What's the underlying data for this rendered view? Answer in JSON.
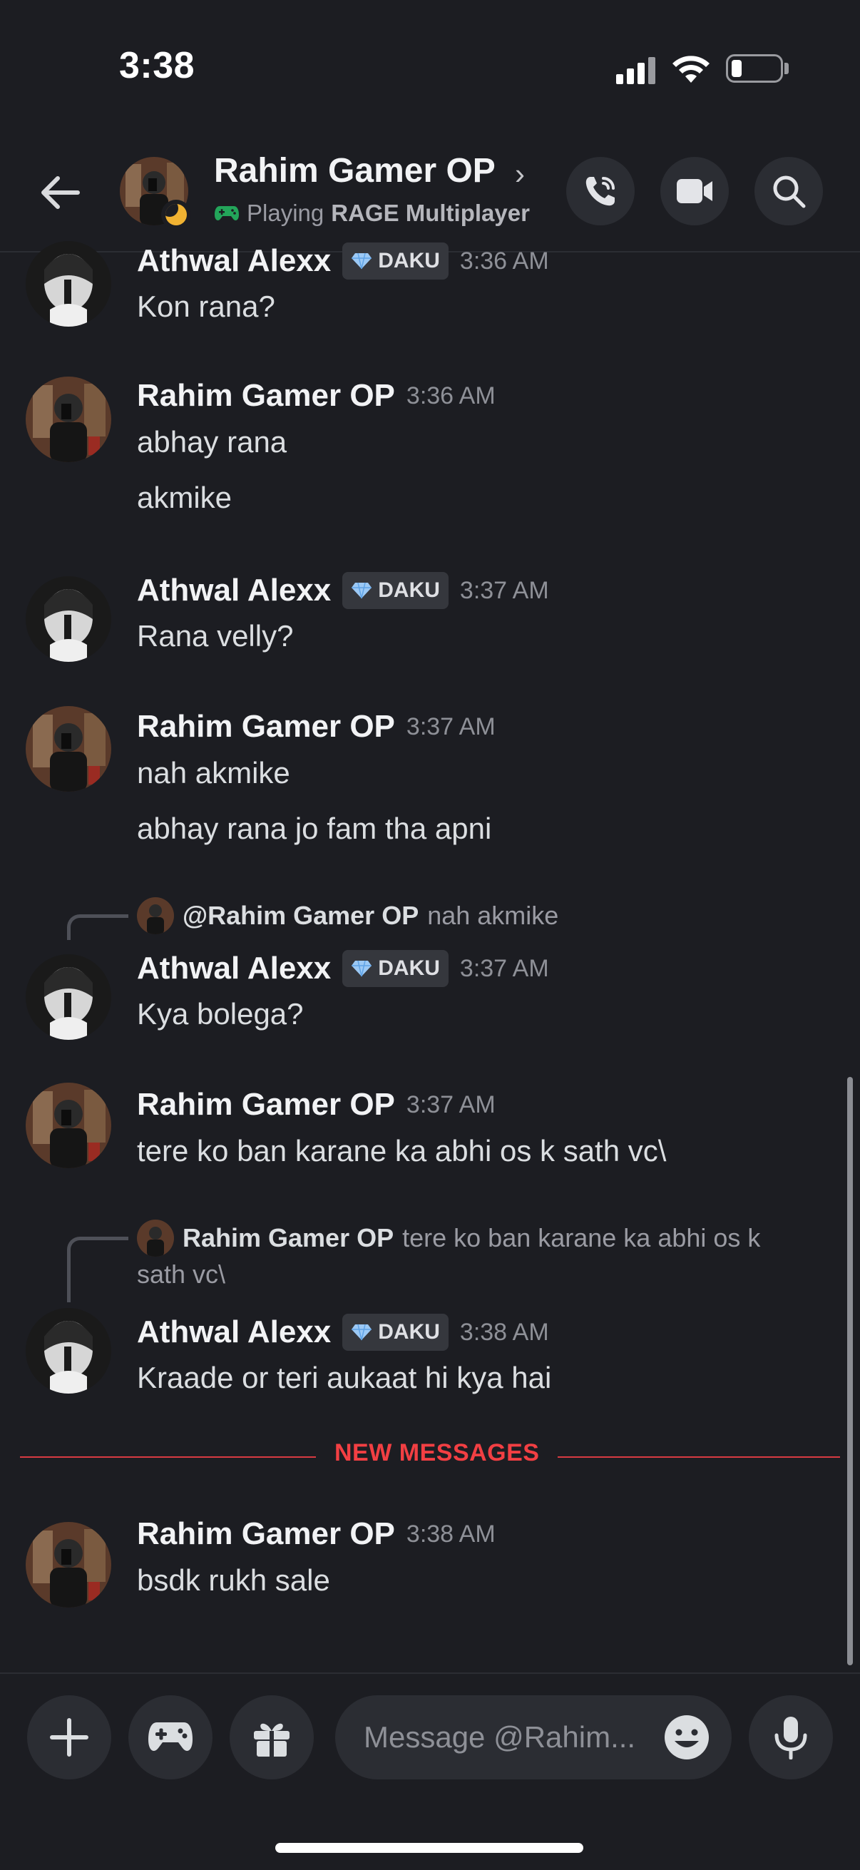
{
  "status_bar": {
    "time": "3:38"
  },
  "header": {
    "name": "Rahim Gamer OP",
    "activity_prefix": "Playing",
    "activity_game": "RAGE Multiplayer",
    "buttons": [
      "call-icon",
      "video-icon",
      "search-icon"
    ]
  },
  "messages": [
    {
      "author": "Athwal Alexx",
      "tag": "DAKU",
      "time": "3:36 AM",
      "lines": [
        "Kon rana?"
      ]
    },
    {
      "author": "Rahim Gamer OP",
      "time": "3:36 AM",
      "lines": [
        "abhay rana",
        "akmike"
      ]
    },
    {
      "author": "Athwal Alexx",
      "tag": "DAKU",
      "time": "3:37 AM",
      "lines": [
        "Rana velly?"
      ]
    },
    {
      "author": "Rahim Gamer OP",
      "time": "3:37 AM",
      "lines": [
        "nah akmike",
        "abhay rana jo fam tha apni"
      ]
    },
    {
      "reply_to": {
        "name": "@Rahim Gamer OP",
        "text": "nah akmike"
      },
      "author": "Athwal Alexx",
      "tag": "DAKU",
      "time": "3:37 AM",
      "lines": [
        "Kya bolega?"
      ]
    },
    {
      "author": "Rahim Gamer OP",
      "time": "3:37 AM",
      "lines": [
        "tere ko ban karane ka abhi os k sath vc\\"
      ]
    },
    {
      "reply_to": {
        "name": "Rahim Gamer OP",
        "text": "tere ko ban karane ka abhi os k",
        "text2": "sath vc\\"
      },
      "author": "Athwal Alexx",
      "tag": "DAKU",
      "time": "3:38 AM",
      "lines": [
        "Kraade or teri aukaat hi kya hai"
      ]
    },
    {
      "author": "Rahim Gamer OP",
      "time": "3:38 AM",
      "lines": [
        "bsdk rukh sale"
      ]
    }
  ],
  "divider": {
    "label": "NEW MESSAGES",
    "color": "#f23f43"
  },
  "composer": {
    "placeholder": "Message @Rahim..."
  },
  "colors": {
    "background": "#1c1d22",
    "accent_green": "#23a55a",
    "idle_moon": "#f0b232"
  }
}
